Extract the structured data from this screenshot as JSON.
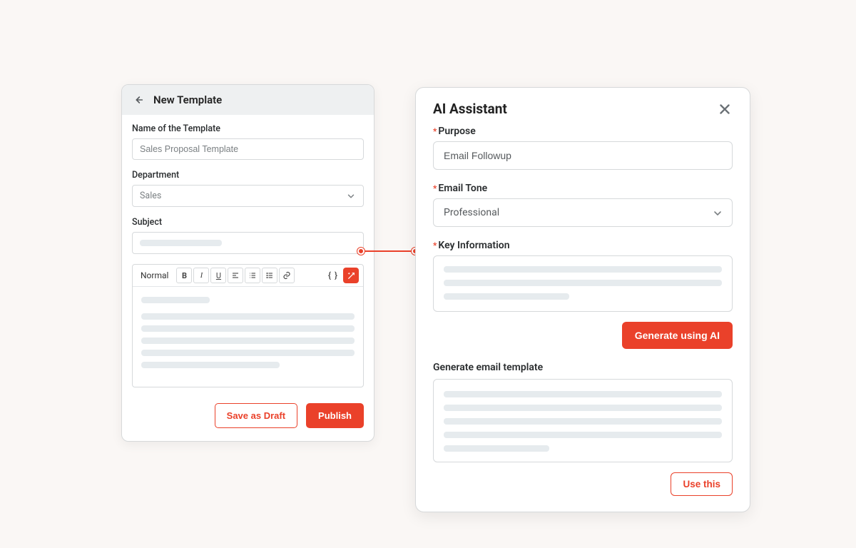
{
  "colors": {
    "accent": "#ea412a"
  },
  "template_panel": {
    "title": "New Template",
    "name_label": "Name of the Template",
    "name_value": "Sales Proposal Template",
    "department_label": "Department",
    "department_value": "Sales",
    "subject_label": "Subject",
    "toolbar": {
      "style": "Normal",
      "bold": "B",
      "italic": "I",
      "underline": "U",
      "braces": "{ }",
      "icons": {
        "align": "align-left-icon",
        "list_ol": "ordered-list-icon",
        "list_ul": "unordered-list-icon",
        "link": "link-icon",
        "ai": "ai-wand-icon"
      }
    },
    "save_draft": "Save as Draft",
    "publish": "Publish"
  },
  "ai_panel": {
    "title": "AI Assistant",
    "purpose_label": "Purpose",
    "purpose_value": "Email Followup",
    "tone_label": "Email Tone",
    "tone_value": "Professional",
    "key_info_label": "Key Information",
    "generate_btn": "Generate using AI",
    "output_title": "Generate email template",
    "use_this": "Use this"
  }
}
